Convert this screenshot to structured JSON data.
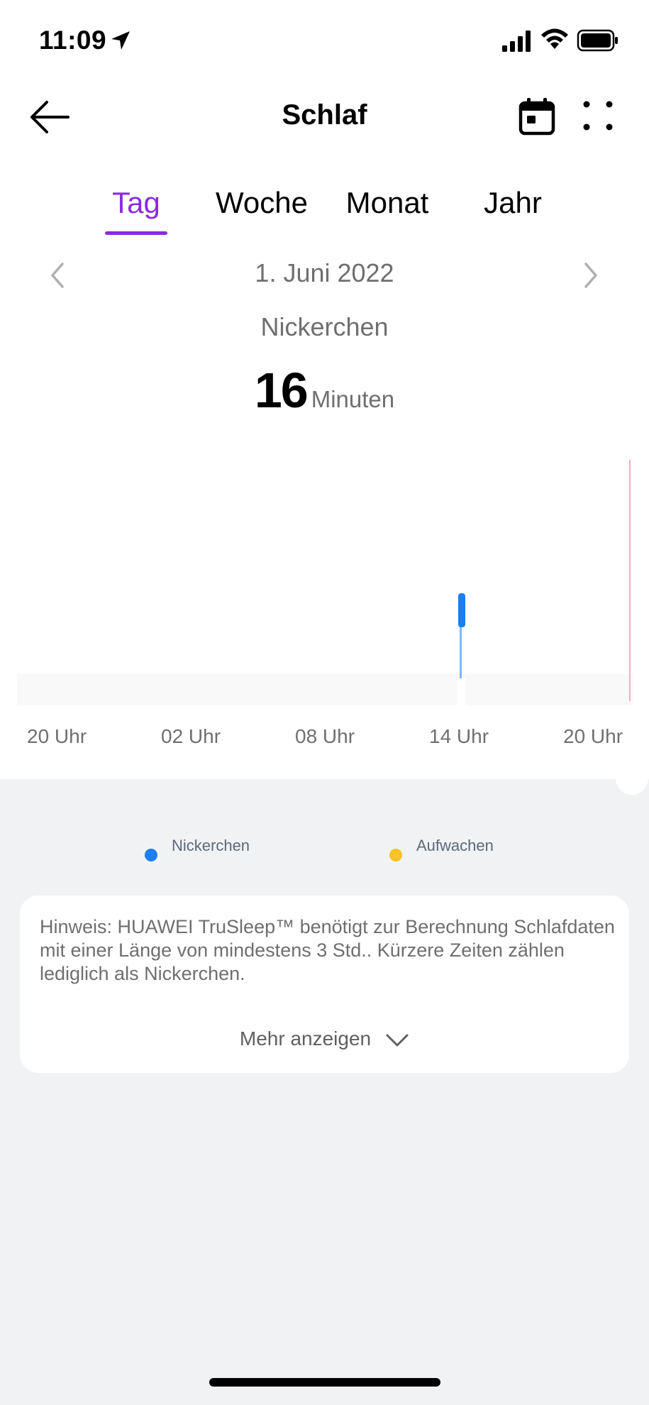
{
  "status_bar": {
    "time": "11:09"
  },
  "nav": {
    "title": "Schlaf"
  },
  "tabs": [
    {
      "label": "Tag",
      "active": true
    },
    {
      "label": "Woche",
      "active": false
    },
    {
      "label": "Monat",
      "active": false
    },
    {
      "label": "Jahr",
      "active": false
    }
  ],
  "date": {
    "text": "1. Juni 2022"
  },
  "metric": {
    "label": "Nickerchen",
    "value": "16",
    "unit": "Minuten"
  },
  "chart_data": {
    "type": "bar",
    "x_ticks": [
      "20 Uhr",
      "02 Uhr",
      "08 Uhr",
      "14 Uhr",
      "20 Uhr"
    ],
    "series": [
      {
        "name": "Nickerchen",
        "color": "#1a7ff0",
        "segments": [
          {
            "start_hour": 14.0,
            "duration_min": 16
          }
        ]
      }
    ],
    "markers": [
      {
        "hour": 20.0,
        "color": "#e89aa8",
        "meaning": "current-time"
      }
    ]
  },
  "legend": [
    {
      "label": "Nickerchen",
      "color": "#1a7ff0"
    },
    {
      "label": "Aufwachen",
      "color": "#f7c325"
    }
  ],
  "info": {
    "text": "Hinweis: HUAWEI TruSleep™ benötigt zur Berechnung Schlafdaten mit einer Länge von mindestens 3 Std.. Kürzere Zeiten zählen lediglich als Nickerchen.",
    "more_label": "Mehr anzeigen"
  },
  "colors": {
    "accent": "#8a2be2",
    "nap": "#1a7ff0",
    "wake": "#f7c325",
    "background": "#f1f2f4"
  }
}
